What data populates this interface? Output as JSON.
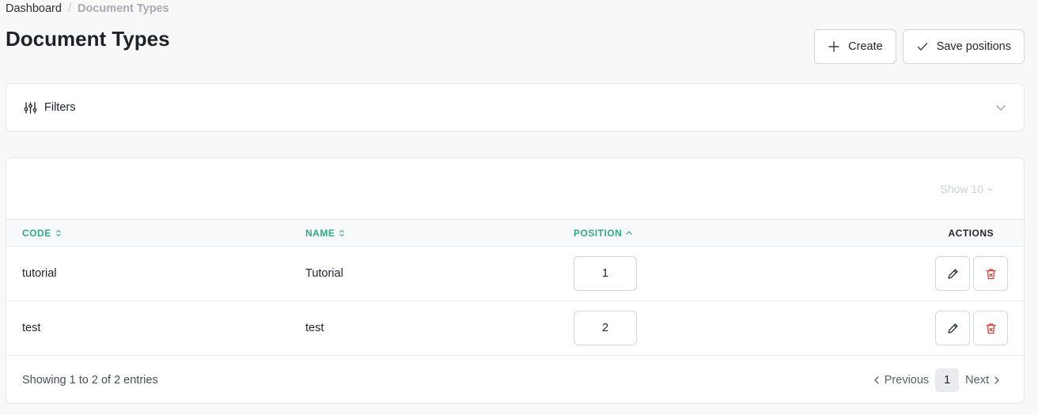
{
  "breadcrumb": {
    "home": "Dashboard",
    "separator": "/",
    "current": "Document Types"
  },
  "page": {
    "title": "Document Types"
  },
  "actions": {
    "create_label": "Create",
    "save_positions_label": "Save positions"
  },
  "filters": {
    "label": "Filters"
  },
  "table": {
    "page_size_label": "Show 10",
    "columns": {
      "code": "CODE",
      "name": "NAME",
      "position": "POSITION",
      "actions": "ACTIONS"
    },
    "rows": [
      {
        "code": "tutorial",
        "name": "Tutorial",
        "position": "1"
      },
      {
        "code": "test",
        "name": "test",
        "position": "2"
      }
    ],
    "entries_text": "Showing 1 to 2 of 2 entries",
    "pagination": {
      "previous": "Previous",
      "current_page": "1",
      "next": "Next"
    }
  },
  "colors": {
    "accent": "#34a88a",
    "delete": "#d43c3c",
    "muted": "#a7abb2"
  },
  "icons": [
    "plus-icon",
    "check-icon",
    "filter-sliders-icon",
    "chevron-down-icon",
    "sort-icon",
    "sort-asc-icon",
    "edit-pencil-icon",
    "trash-icon",
    "chevron-left-icon",
    "chevron-right-icon"
  ]
}
